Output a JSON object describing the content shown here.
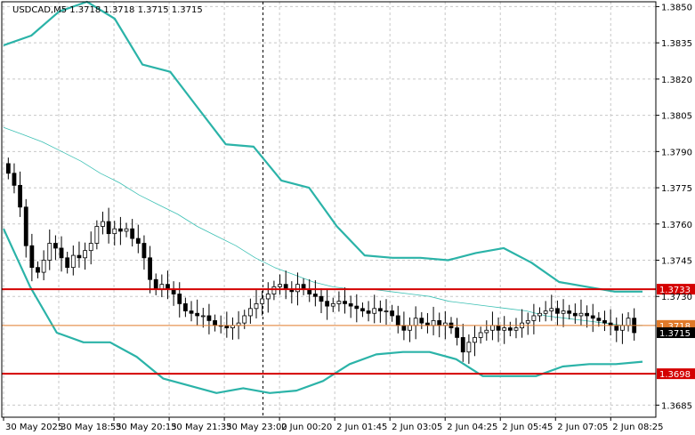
{
  "chart_data": {
    "type": "candlestick",
    "symbol_header": "USDCAD,M5  1.3718 1.3718 1.3715 1.3715",
    "ohlc_current": {
      "open": 1.3718,
      "high": 1.3718,
      "low": 1.3715,
      "close": 1.3715
    },
    "ylim": [
      1.368,
      1.3852
    ],
    "y_ticks": [
      {
        "value": 1.385,
        "label": "1.3850"
      },
      {
        "value": 1.3835,
        "label": "1.3835"
      },
      {
        "value": 1.382,
        "label": "1.3820"
      },
      {
        "value": 1.3805,
        "label": "1.3805"
      },
      {
        "value": 1.379,
        "label": "1.3790"
      },
      {
        "value": 1.3775,
        "label": "1.3775"
      },
      {
        "value": 1.376,
        "label": "1.3760"
      },
      {
        "value": 1.3745,
        "label": "1.3745"
      },
      {
        "value": 1.373,
        "label": "1.3730"
      },
      {
        "value": 1.3685,
        "label": "1.3685"
      }
    ],
    "x_ticks": [
      "30 May 2025",
      "30 May 18:55",
      "30 May 20:15",
      "30 May 21:35",
      "30 May 23:00",
      "2 Jun 00:20",
      "2 Jun 01:45",
      "2 Jun 03:05",
      "2 Jun 04:25",
      "2 Jun 05:45",
      "2 Jun 07:05",
      "2 Jun 08:25"
    ],
    "levels": [
      {
        "value": 1.3733,
        "label": "1.3733",
        "color": "#d40000"
      },
      {
        "value": 1.3718,
        "label": "1.3718",
        "color": "#e07a2a"
      },
      {
        "value": 1.3715,
        "label": "1.3715",
        "color": "#000000"
      },
      {
        "value": 1.3698,
        "label": "1.3698",
        "color": "#d40000"
      }
    ],
    "candle_closes": [
      1.3781,
      1.3776,
      1.3767,
      1.3751,
      1.3742,
      1.374,
      1.3745,
      1.3752,
      1.375,
      1.3746,
      1.3742,
      1.3747,
      1.3746,
      1.3749,
      1.3752,
      1.3759,
      1.3761,
      1.3756,
      1.3758,
      1.3757,
      1.3758,
      1.3754,
      1.3752,
      1.3746,
      1.3737,
      1.3733,
      1.3735,
      1.3733,
      1.3731,
      1.3727,
      1.3724,
      1.3723,
      1.3722,
      1.3722,
      1.372,
      1.3718,
      1.3718,
      1.3717,
      1.3718,
      1.3719,
      1.3722,
      1.3725,
      1.3727,
      1.3729,
      1.3731,
      1.3734,
      1.3735,
      1.3733,
      1.3732,
      1.3735,
      1.3733,
      1.3731,
      1.373,
      1.3728,
      1.3726,
      1.3727,
      1.3728,
      1.3727,
      1.3726,
      1.3725,
      1.3724,
      1.3723,
      1.3725,
      1.3724,
      1.3724,
      1.3722,
      1.3718,
      1.3716,
      1.3718,
      1.3721,
      1.3719,
      1.3718,
      1.372,
      1.3718,
      1.3719,
      1.3717,
      1.3713,
      1.3707,
      1.3711,
      1.3713,
      1.3715,
      1.3716,
      1.3718,
      1.3716,
      1.3717,
      1.3716,
      1.3717,
      1.3719,
      1.372,
      1.3722,
      1.3723,
      1.3724,
      1.3725,
      1.3723,
      1.3724,
      1.3723,
      1.3722,
      1.3723,
      1.3722,
      1.3721,
      1.372,
      1.3719,
      1.3718,
      1.3716,
      1.3718,
      1.3721,
      1.3715
    ],
    "ma_middle": [
      1.38,
      1.3797,
      1.3794,
      1.379,
      1.3786,
      1.3781,
      1.3777,
      1.3772,
      1.3768,
      1.3764,
      1.3759,
      1.3755,
      1.3751,
      1.3746,
      1.3742,
      1.3739,
      1.3736,
      1.3734,
      1.3733,
      1.3733,
      1.3732,
      1.3731,
      1.373,
      1.3728,
      1.3727,
      1.3726,
      1.3725,
      1.3724,
      1.3722,
      1.3721,
      1.372,
      1.3719,
      1.3718,
      1.3718
    ],
    "band_upper": [
      1.3834,
      1.3838,
      1.3848,
      1.3852,
      1.3845,
      1.3826,
      1.3823,
      1.3808,
      1.3793,
      1.3792,
      1.3778,
      1.3775,
      1.3759,
      1.3747,
      1.3746,
      1.3746,
      1.3745,
      1.3748,
      1.375,
      1.3744,
      1.3736,
      1.3734,
      1.3732,
      1.3732
    ],
    "band_lower": [
      1.3758,
      1.3734,
      1.3715,
      1.3711,
      1.3711,
      1.3705,
      1.3696,
      1.3693,
      1.369,
      1.3692,
      1.369,
      1.3691,
      1.3695,
      1.3702,
      1.3706,
      1.3707,
      1.3707,
      1.3704,
      1.3697,
      1.3697,
      1.3697,
      1.3701,
      1.3702,
      1.3702,
      1.3703
    ]
  }
}
